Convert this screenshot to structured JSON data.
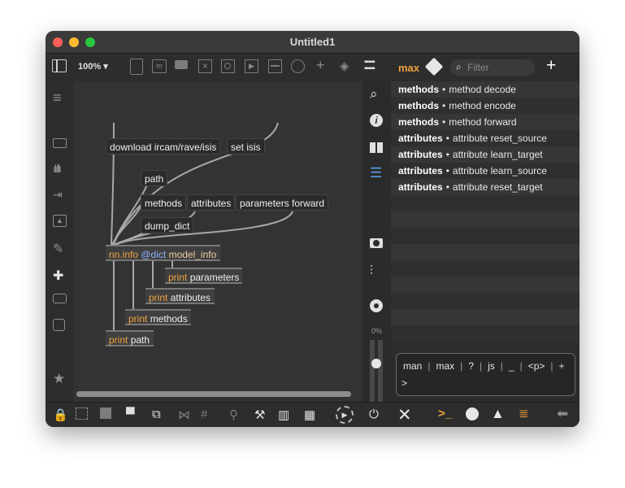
{
  "window": {
    "title": "Untitled1"
  },
  "toolbar": {
    "zoom": "100% ▾"
  },
  "patch": {
    "messages": {
      "download": "download ircam/rave/isis",
      "set_isis": "set isis",
      "path": "path",
      "methods": "methods",
      "attributes": "attributes",
      "parameters_forward": "parameters forward",
      "dump_dict": "dump_dict"
    },
    "nn_info": {
      "name": "nn.info",
      "attr": "@dict",
      "arg": "model_info"
    },
    "prints": [
      {
        "kw": "print",
        "arg": "parameters"
      },
      {
        "kw": "print",
        "arg": "attributes"
      },
      {
        "kw": "print",
        "arg": "methods"
      },
      {
        "kw": "print",
        "arg": "path"
      }
    ]
  },
  "sidebar_percent": "0%",
  "right_pane": {
    "tab_label": "max",
    "filter_placeholder": "Filter",
    "add_label": "+",
    "entries": [
      {
        "category": "methods",
        "sep": "•",
        "text": "method decode"
      },
      {
        "category": "methods",
        "sep": "•",
        "text": "method encode"
      },
      {
        "category": "methods",
        "sep": "•",
        "text": "method forward"
      },
      {
        "category": "attributes",
        "sep": "•",
        "text": "attribute reset_source"
      },
      {
        "category": "attributes",
        "sep": "•",
        "text": "attribute learn_target"
      },
      {
        "category": "attributes",
        "sep": "•",
        "text": "attribute learn_source"
      },
      {
        "category": "attributes",
        "sep": "•",
        "text": "attribute reset_target"
      }
    ],
    "console": {
      "shortcuts": [
        "man",
        "|",
        "max",
        "|",
        "?",
        "|",
        "js",
        "|",
        "_",
        "|",
        "<p>",
        "|",
        "+"
      ],
      "prompt": ">"
    }
  },
  "colors": {
    "accent": "#f0a33c",
    "object": "#3d3d3d",
    "canvas": "#333333",
    "cord": "#a8a8a8"
  },
  "icons": {
    "toolbar": [
      "sidebar-toggle-icon",
      "presentation-icon",
      "comment-box-icon",
      "comment-icon",
      "toggle-box-icon",
      "button-box-icon",
      "number-box-icon",
      "slider-icon",
      "dial-icon",
      "add-object-icon",
      "paint-bucket-icon",
      "grid-keyboard-icon"
    ],
    "left": [
      "menu-icon",
      "device-icon",
      "waveform-icon",
      "sequence-icon",
      "image-icon",
      "paperclip-icon",
      "plug-icon",
      "package-icon",
      "project-icon",
      "star-icon"
    ],
    "mid": [
      "search-icon",
      "info-icon",
      "reference-icon",
      "list-icon",
      "snapshot-icon",
      "mixer-icon",
      "record-icon"
    ],
    "bottom": [
      "lock-icon",
      "select-icon",
      "layer-icon",
      "presentation-mode-icon",
      "front-back-icon",
      "mute-icon",
      "grid-icon",
      "pin-icon",
      "wrench-icon",
      "piano-icon",
      "keyboard-icon",
      "audio-dsp-icon",
      "power-icon"
    ],
    "right_bottom": [
      "close-icon",
      "console-icon",
      "clock-icon",
      "warning-icon",
      "stack-icon",
      "back-arrow-icon"
    ]
  }
}
